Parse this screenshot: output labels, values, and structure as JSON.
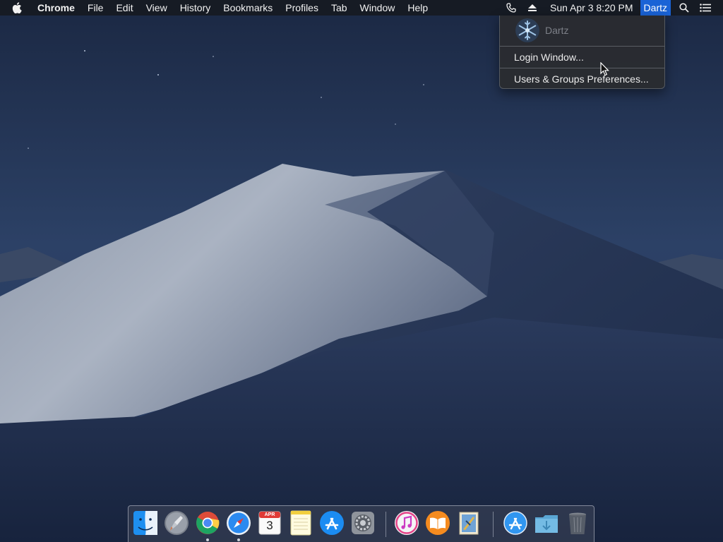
{
  "menubar": {
    "apple_icon": "apple-icon",
    "app_name": "Chrome",
    "menus": [
      "File",
      "Edit",
      "View",
      "History",
      "Bookmarks",
      "Profiles",
      "Tab",
      "Window",
      "Help"
    ],
    "status_icons": [
      "phone-icon",
      "eject-icon"
    ],
    "clock": "Sun Apr 3  8:20 PM",
    "user": "Dartz",
    "right_icons": [
      "spotlight-search-icon",
      "notification-center-icon"
    ]
  },
  "user_menu": {
    "name": "Dartz",
    "avatar": "snowflake-avatar",
    "items": [
      "Login Window...",
      "Users & Groups Preferences..."
    ]
  },
  "dock": {
    "apps": [
      {
        "name": "Finder",
        "icon": "finder-icon",
        "running": false
      },
      {
        "name": "Launchpad",
        "icon": "launchpad-icon",
        "running": false
      },
      {
        "name": "Google Chrome",
        "icon": "chrome-icon",
        "running": true
      },
      {
        "name": "Safari",
        "icon": "safari-icon",
        "running": true
      },
      {
        "name": "Calendar",
        "icon": "calendar-icon",
        "running": false,
        "month": "APR",
        "day": "3"
      },
      {
        "name": "Notes",
        "icon": "notes-icon",
        "running": false
      },
      {
        "name": "App Store",
        "icon": "app-store-icon",
        "running": false
      },
      {
        "name": "System Preferences",
        "icon": "system-preferences-icon",
        "running": false
      },
      {
        "name": "iTunes",
        "icon": "itunes-icon",
        "running": false
      },
      {
        "name": "iBooks",
        "icon": "ibooks-icon",
        "running": false
      },
      {
        "name": "Mail",
        "icon": "mail-icon",
        "running": false
      }
    ],
    "stacks": [
      {
        "name": "Applications",
        "icon": "app-store-stack-icon"
      },
      {
        "name": "Downloads",
        "icon": "downloads-folder-icon"
      },
      {
        "name": "Trash",
        "icon": "trash-icon"
      }
    ]
  },
  "colors": {
    "menubar_bg": "#16191f",
    "selected_user_bg": "#1a63d6",
    "menu_bg": "#2a2c30"
  }
}
